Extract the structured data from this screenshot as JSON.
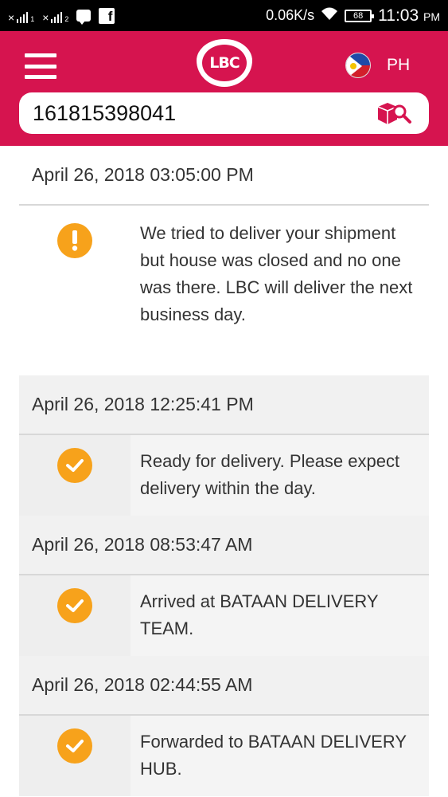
{
  "status_bar": {
    "network_speed": "0.06K/s",
    "battery": "68",
    "time": "11:03",
    "ampm": "PM"
  },
  "header": {
    "logo_text": "LBC",
    "region": "PH"
  },
  "search": {
    "value": "161815398041"
  },
  "timeline": [
    {
      "date": "April 26, 2018 03:05:00 PM",
      "icon": "exclamation-icon",
      "text": "We tried to deliver your shipment but house was closed and no one was there. LBC will deliver the next business day."
    },
    {
      "date": "April 26, 2018 12:25:41 PM",
      "icon": "check-icon",
      "text": "Ready for delivery. Please expect delivery within the day."
    },
    {
      "date": "April 26, 2018 08:53:47 AM",
      "icon": "check-icon",
      "text": "Arrived at BATAAN DELIVERY TEAM."
    },
    {
      "date": "April 26, 2018 02:44:55 AM",
      "icon": "check-icon",
      "text": "Forwarded to BATAAN DELIVERY HUB."
    }
  ],
  "colors": {
    "brand": "#d6144f",
    "status_orange": "#f7a21b"
  }
}
